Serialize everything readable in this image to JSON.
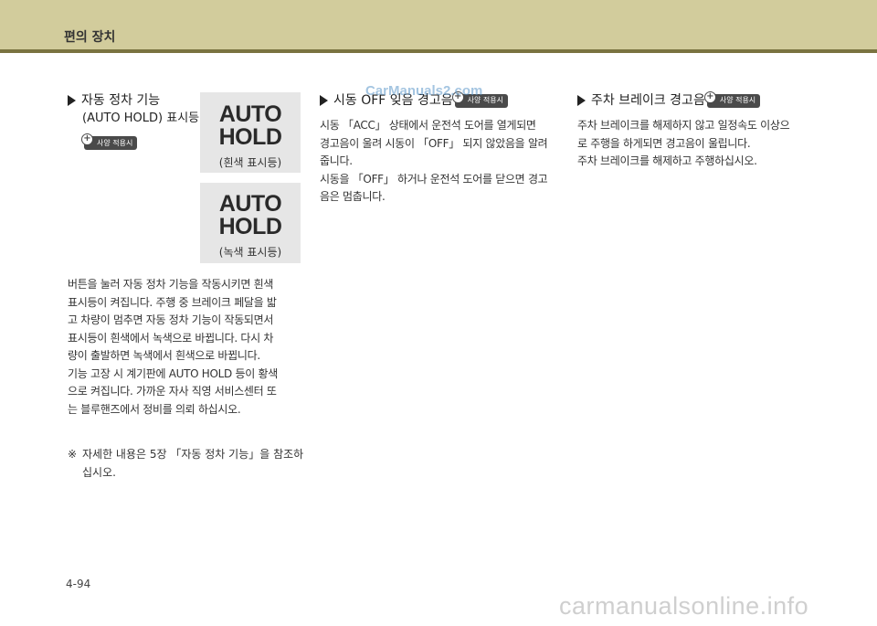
{
  "header": {
    "title": "편의 장치"
  },
  "col1": {
    "heading": "자동 정차 기능",
    "subheading": "(AUTO HOLD) 표시등",
    "badge": "사양 적용시",
    "indicator1": {
      "line1": "AUTO",
      "line2": "HOLD",
      "caption": "(흰색 표시등)"
    },
    "indicator2": {
      "line1": "AUTO",
      "line2": "HOLD",
      "caption": "(녹색 표시등)"
    },
    "paragraph_lines": [
      "버튼을 눌러 자동 정차 기능을 작동시키면 흰색",
      "표시등이 켜집니다. 주행 중 브레이크 페달을 밟",
      "고 차량이 멈추면 자동 정차 기능이 작동되면서",
      "표시등이 흰색에서 녹색으로 바뀝니다. 다시 차",
      "량이 출발하면 녹색에서 흰색으로 바뀝니다.",
      "기능 고장 시 계기판에 AUTO HOLD 등이 황색",
      "으로  켜집니다. 가까운 자사 직영 서비스센터 또",
      "는 블루핸즈에서 정비를 의뢰 하십시오."
    ],
    "note_mark": "※",
    "note_lines": [
      "자세한 내용은 5장 「자동 정차 기능」을 참조하",
      "십시오."
    ]
  },
  "col2": {
    "heading": "시동 OFF 잊음 경고음",
    "badge": "사양 적용시",
    "paragraph_lines": [
      "시동 「ACC」 상태에서 운전석 도어를 열게되면",
      "경고음이 울려 시동이 「OFF」 되지 않았음을 알려",
      "줍니다.",
      "시동을 「OFF」 하거나 운전석 도어를 닫으면 경고",
      "음은 멈춥니다."
    ]
  },
  "col3": {
    "heading": "주차 브레이크 경고음",
    "badge": "사양 적용시",
    "paragraph_lines": [
      "주차 브레이크를 해제하지 않고 일정속도 이상으",
      "로 주행을 하게되면 경고음이 울립니다.",
      "주차 브레이크를 해제하고 주행하십시오."
    ]
  },
  "page_number": "4-94",
  "watermarks": {
    "top": "CarManuals2.com",
    "bottom": "carmanualsonline.info"
  }
}
